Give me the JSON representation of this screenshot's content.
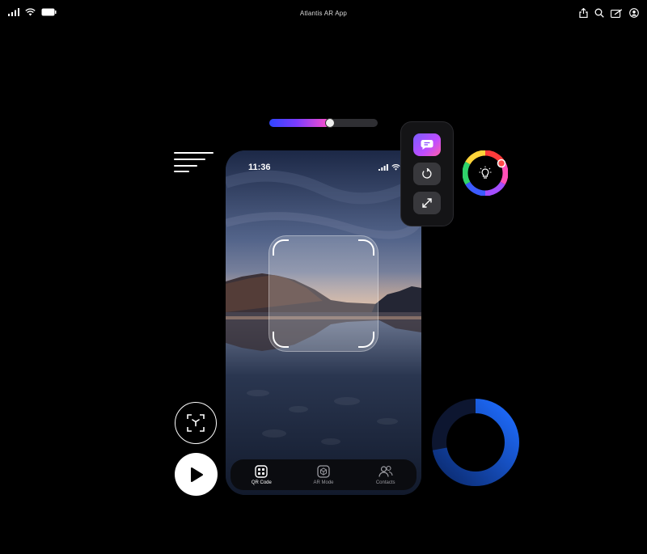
{
  "status_bar": {
    "app_title": "Atlantis AR App",
    "left_icons": [
      "signal-icon",
      "wifi-icon",
      "battery-icon"
    ],
    "right_icons": [
      "share-icon",
      "search-icon",
      "edit-icon",
      "account-icon"
    ]
  },
  "slider": {
    "value_fraction": 0.56,
    "gradient_colors": [
      "#2f45ff",
      "#7b3cff",
      "#ff4fc8"
    ]
  },
  "phone": {
    "time": "11:36",
    "status_icons": [
      "signal-icon",
      "wifi-icon",
      "battery-icon"
    ],
    "tabs": [
      {
        "label": "QR Code",
        "icon": "qr-code-icon",
        "active": true
      },
      {
        "label": "AR Mode",
        "icon": "ar-cube-icon",
        "active": false
      },
      {
        "label": "Contacts",
        "icon": "contacts-icon",
        "active": false
      }
    ]
  },
  "tool_panel": {
    "buttons": [
      "chat-icon",
      "rotate-icon",
      "expand-icon"
    ]
  },
  "color_picker": {
    "center_icon": "lightbulb-icon"
  },
  "progress_ring": {
    "value_fraction": 0.72,
    "color": "#1e6cff"
  },
  "colors": {
    "background": "#000000",
    "accent": "#1e6cff",
    "chat_gradient": [
      "#7a5cff",
      "#ff5fa8"
    ]
  }
}
